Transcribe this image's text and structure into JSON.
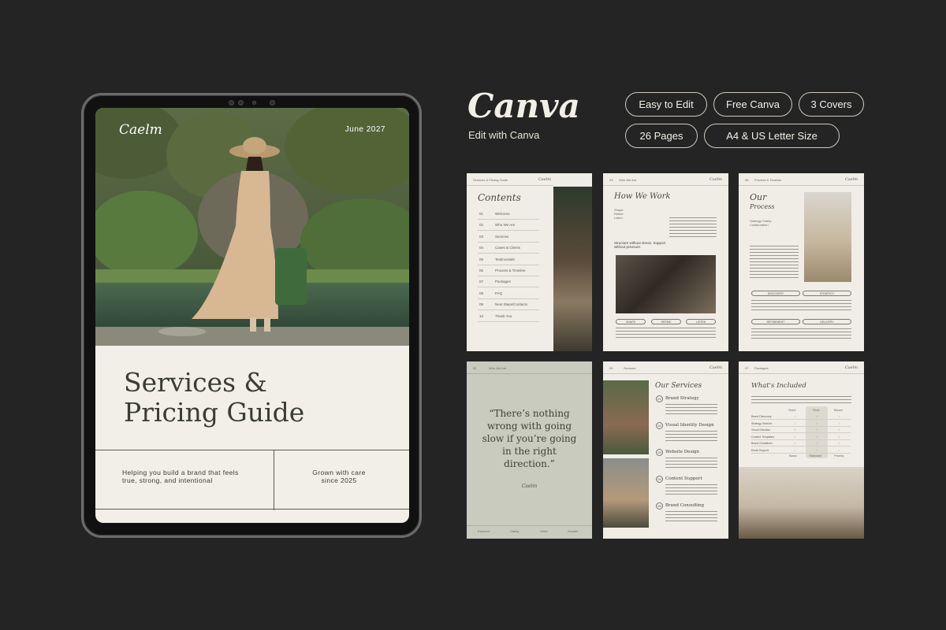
{
  "tablet_cover": {
    "logo": "Caelm",
    "date": "June 2027",
    "title_line1": "Services &",
    "title_line2": "Pricing Guide",
    "footer_left": "Helping you build a brand that feels true, strong, and intentional",
    "footer_right": "Grown with care since 2025"
  },
  "header": {
    "brand": "Canva",
    "subtitle": "Edit with Canva",
    "pills": [
      "Easy to Edit",
      "Free Canva",
      "3 Covers",
      "26 Pages",
      "A4 & US Letter Size"
    ]
  },
  "pages": {
    "contents": {
      "header": "Services & Pricing Guide",
      "logo": "Caelm",
      "title": "Contents",
      "items": [
        {
          "num": "01",
          "label": "Welcome"
        },
        {
          "num": "02",
          "label": "Who We Are"
        },
        {
          "num": "03",
          "label": "Services"
        },
        {
          "num": "04",
          "label": "Cases & Clients"
        },
        {
          "num": "05",
          "label": "Testimonials"
        },
        {
          "num": "06",
          "label": "Process & Timeline"
        },
        {
          "num": "07",
          "label": "Packages"
        },
        {
          "num": "08",
          "label": "FAQ"
        },
        {
          "num": "09",
          "label": "Next Steps/Contacts"
        },
        {
          "num": "10",
          "label": "Thank You"
        }
      ]
    },
    "how_we_work": {
      "header": "Who We Are",
      "num": "03",
      "logo": "Caelm",
      "title": "How We Work",
      "list": "Shape Refine Listen",
      "tagline": "Structure without stress. Support without pressure.",
      "pills": [
        "SHAPE",
        "REFINE",
        "LISTEN"
      ]
    },
    "process": {
      "header": "Process & Timeline",
      "num": "06",
      "logo": "Caelm",
      "title_line1": "Our",
      "title_line2": "Process",
      "list": "Strategy Clarity Collaboration",
      "pills": [
        "DISCOVERY",
        "STRATEGY",
        "REFINEMENT",
        "DELIVERY"
      ]
    },
    "quote": {
      "header": "Who We Are",
      "num": "02",
      "quote": "“There’s nothing wrong with going slow if you’re going in the right direction.”",
      "logo": "Caelm",
      "footer": [
        "Essence",
        "Clarity",
        "Voice",
        "Growth"
      ]
    },
    "services": {
      "header": "Services",
      "num": "03",
      "logo": "Caelm",
      "title": "Our Services",
      "items": [
        {
          "num": "01",
          "name": "Brand Strategy"
        },
        {
          "num": "02",
          "name": "Visual Identity Design"
        },
        {
          "num": "03",
          "name": "Website Design"
        },
        {
          "num": "04",
          "name": "Content Support"
        },
        {
          "num": "05",
          "name": "Brand Consulting"
        }
      ]
    },
    "included": {
      "header": "Packages",
      "num": "07",
      "logo": "Caelm",
      "title": "What's Included",
      "columns": [
        "Seed",
        "Root",
        "Bloom"
      ],
      "rows": [
        "Brand Discovery",
        "Strategy Session",
        "Visual Direction",
        "Content Templates",
        "Brand Guidelines",
        "Email Support"
      ],
      "footer": [
        "Basic",
        "Standard",
        "Priority"
      ]
    }
  },
  "colors": {
    "background": "#242424",
    "paper": "#f0ede6",
    "sage": "#c8cbbd",
    "ink": "#3a3d33"
  }
}
